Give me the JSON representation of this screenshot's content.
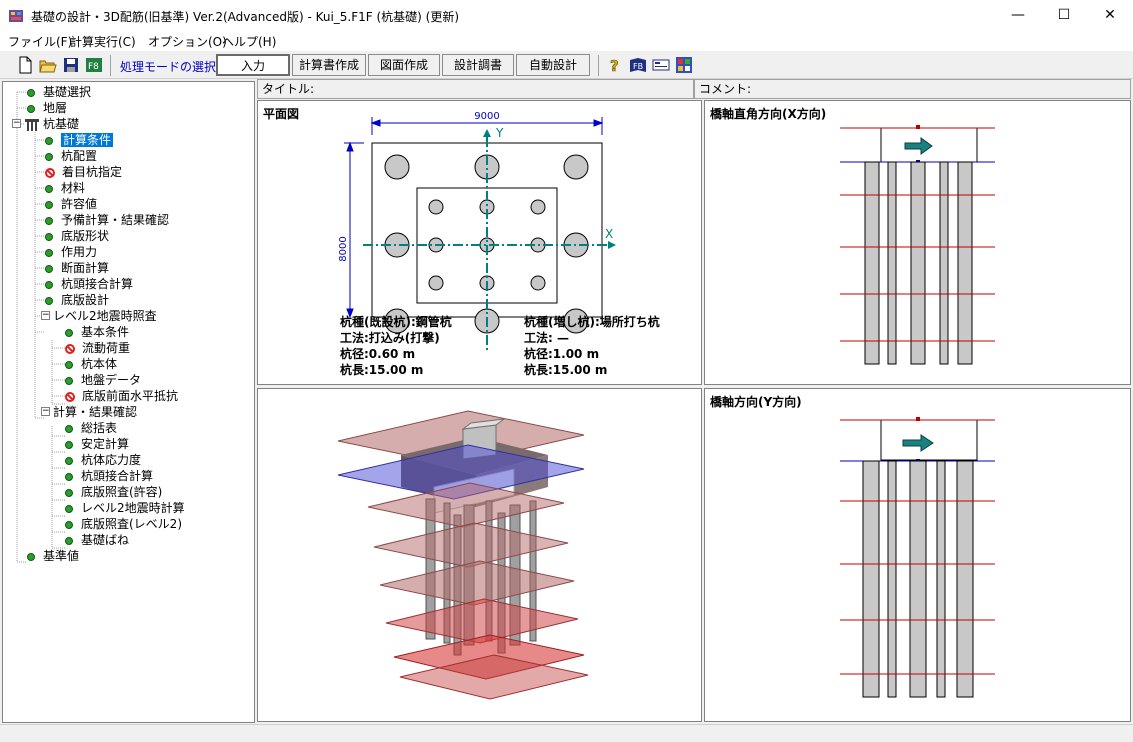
{
  "window": {
    "title": "基礎の設計・3D配筋(旧基準) Ver.2(Advanced版) - Kui_5.F1F (杭基礎) (更新)",
    "minimize": "—",
    "maximize": "☐",
    "close": "✕"
  },
  "menu": [
    "ファイル(F)",
    "計算実行(C)",
    "オプション(O)",
    "ヘルプ(H)"
  ],
  "toolbar": {
    "mode_label": "処理モードの選択",
    "buttons": [
      "入力",
      "計算書作成",
      "図面作成",
      "設計調書",
      "自動設計"
    ],
    "icons": [
      "new-file-icon",
      "open-folder-icon",
      "save-icon",
      "export-icon",
      "help-icon",
      "manual-icon",
      "card-icon",
      "web-icon"
    ]
  },
  "headers": {
    "title_label": "タイトル:",
    "comment_label": "コメント:"
  },
  "tree": [
    {
      "label": "基礎選択",
      "icon": "dot",
      "level": 1
    },
    {
      "label": "地層",
      "icon": "dot",
      "level": 1
    },
    {
      "label": "杭基礎",
      "icon": "pile",
      "level": 0,
      "expander": "−"
    },
    {
      "label": "計算条件",
      "icon": "dot",
      "level": 2,
      "selected": true
    },
    {
      "label": "杭配置",
      "icon": "dot",
      "level": 2
    },
    {
      "label": "着目杭指定",
      "icon": "noentry",
      "level": 2
    },
    {
      "label": "材料",
      "icon": "dot",
      "level": 2
    },
    {
      "label": "許容値",
      "icon": "dot",
      "level": 2
    },
    {
      "label": "予備計算・結果確認",
      "icon": "dot",
      "level": 2
    },
    {
      "label": "底版形状",
      "icon": "dot",
      "level": 2
    },
    {
      "label": "作用力",
      "icon": "dot",
      "level": 2
    },
    {
      "label": "断面計算",
      "icon": "dot",
      "level": 2
    },
    {
      "label": "杭頭接合計算",
      "icon": "dot",
      "level": 2
    },
    {
      "label": "底版設計",
      "icon": "dot",
      "level": 2
    },
    {
      "label": "レベル2地震時照査",
      "icon": "none",
      "level": 2,
      "expander": "−"
    },
    {
      "label": "基本条件",
      "icon": "dot",
      "level": 3
    },
    {
      "label": "流動荷重",
      "icon": "noentry",
      "level": 3
    },
    {
      "label": "杭本体",
      "icon": "dot",
      "level": 3
    },
    {
      "label": "地盤データ",
      "icon": "dot",
      "level": 3
    },
    {
      "label": "底版前面水平抵抗",
      "icon": "noentry",
      "level": 3
    },
    {
      "label": "計算・結果確認",
      "icon": "none",
      "level": 2,
      "expander": "−"
    },
    {
      "label": "総括表",
      "icon": "dot",
      "level": 3
    },
    {
      "label": "安定計算",
      "icon": "dot",
      "level": 3
    },
    {
      "label": "杭体応力度",
      "icon": "dot",
      "level": 3
    },
    {
      "label": "杭頭接合計算",
      "icon": "dot",
      "level": 3
    },
    {
      "label": "底版照査(許容)",
      "icon": "dot",
      "level": 3
    },
    {
      "label": "レベル2地震時計算",
      "icon": "dot",
      "level": 3
    },
    {
      "label": "底版照査(レベル2)",
      "icon": "dot",
      "level": 3
    },
    {
      "label": "基礎ばね",
      "icon": "dot",
      "level": 3
    },
    {
      "label": "基準値",
      "icon": "dot",
      "level": 1
    }
  ],
  "plan": {
    "title": "平面図",
    "width_dim": "9000",
    "depth_dim": "8000",
    "y_axis": "Y",
    "x_axis": "X",
    "existing": {
      "type": "杭種(既設杭):鋼管杭",
      "method": "工法:打込み(打撃)",
      "diameter": "杭径:0.60 m",
      "length": "杭長:15.00 m"
    },
    "added": {
      "type": "杭種(増し杭):場所打ち杭",
      "method": "工法: —",
      "diameter": "杭径:1.00 m",
      "length": "杭長:15.00 m"
    }
  },
  "xview": {
    "title": "橋軸直角方向(X方向)"
  },
  "yview": {
    "title": "橋軸方向(Y方向)"
  },
  "colors": {
    "dim": "#0000c8",
    "axis": "#008080",
    "layer": "#c00000"
  }
}
